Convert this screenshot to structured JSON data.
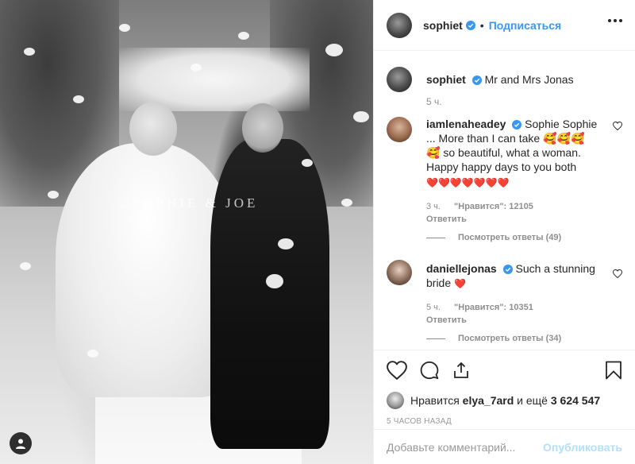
{
  "photo": {
    "watermark": "©SOPHIE & JOE",
    "tag_icon": "user-icon"
  },
  "header": {
    "username": "sophiet",
    "follow_label": "Подписаться",
    "verified_icon": "verified-badge-icon",
    "more_icon": "more-options-icon"
  },
  "caption": {
    "username": "sophiet",
    "text": "Mr and Mrs Jonas",
    "time": "5 ч."
  },
  "comments": [
    {
      "username": "iamlenaheadey",
      "text_1": "Sophie Sophie ... More than I can take",
      "emoji_1": "🥰🥰🥰",
      "emoji_2": "🥰",
      "text_2": "so beautiful, what a woman. Happy happy days to you both",
      "emoji_3": "❤️❤️❤️❤️❤️❤️❤️",
      "time": "3 ч.",
      "likes": "\"Нравится\": 12105",
      "reply": "Ответить",
      "view_replies": "Посмотреть ответы (49)"
    },
    {
      "username": "daniellejonas",
      "text_1": "Such a stunning bride",
      "emoji_1": "❤️",
      "time": "5 ч.",
      "likes": "\"Нравится\": 10351",
      "reply": "Ответить",
      "view_replies": "Посмотреть ответы (34)"
    }
  ],
  "actions": {
    "like_icon": "heart-icon",
    "comment_icon": "comment-icon",
    "share_icon": "share-icon",
    "save_icon": "bookmark-icon",
    "liked_by_prefix": "Нравится",
    "liked_by_user": "elya_7ard",
    "liked_by_suffix": "и ещё",
    "liked_by_count": "3 624 547",
    "time": "5 ЧАСОВ НАЗАД"
  },
  "add_comment": {
    "placeholder": "Добавьте комментарий...",
    "publish_label": "Опубликовать"
  },
  "colors": {
    "link_blue": "#3897f0",
    "publish_disabled": "#b2dffc",
    "heart_red": "#ed4956"
  }
}
